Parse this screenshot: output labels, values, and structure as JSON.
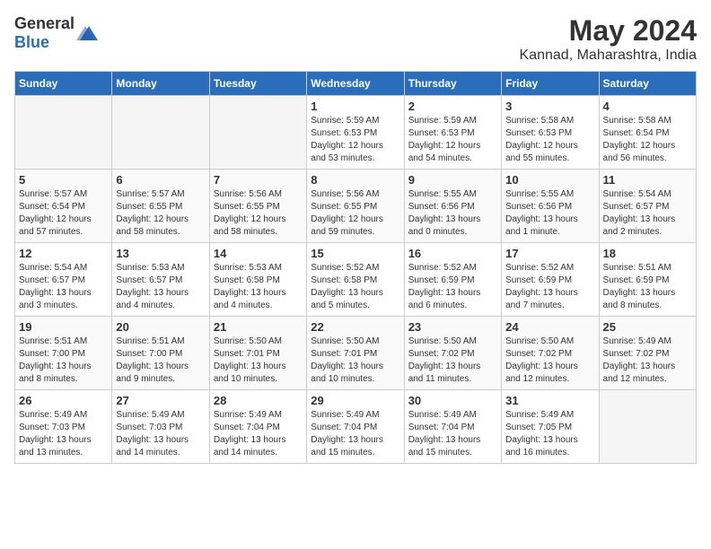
{
  "header": {
    "logo_general": "General",
    "logo_blue": "Blue",
    "month": "May 2024",
    "location": "Kannad, Maharashtra, India"
  },
  "weekdays": [
    "Sunday",
    "Monday",
    "Tuesday",
    "Wednesday",
    "Thursday",
    "Friday",
    "Saturday"
  ],
  "weeks": [
    [
      {
        "day": "",
        "info": ""
      },
      {
        "day": "",
        "info": ""
      },
      {
        "day": "",
        "info": ""
      },
      {
        "day": "1",
        "info": "Sunrise: 5:59 AM\nSunset: 6:53 PM\nDaylight: 12 hours\nand 53 minutes."
      },
      {
        "day": "2",
        "info": "Sunrise: 5:59 AM\nSunset: 6:53 PM\nDaylight: 12 hours\nand 54 minutes."
      },
      {
        "day": "3",
        "info": "Sunrise: 5:58 AM\nSunset: 6:53 PM\nDaylight: 12 hours\nand 55 minutes."
      },
      {
        "day": "4",
        "info": "Sunrise: 5:58 AM\nSunset: 6:54 PM\nDaylight: 12 hours\nand 56 minutes."
      }
    ],
    [
      {
        "day": "5",
        "info": "Sunrise: 5:57 AM\nSunset: 6:54 PM\nDaylight: 12 hours\nand 57 minutes."
      },
      {
        "day": "6",
        "info": "Sunrise: 5:57 AM\nSunset: 6:55 PM\nDaylight: 12 hours\nand 58 minutes."
      },
      {
        "day": "7",
        "info": "Sunrise: 5:56 AM\nSunset: 6:55 PM\nDaylight: 12 hours\nand 58 minutes."
      },
      {
        "day": "8",
        "info": "Sunrise: 5:56 AM\nSunset: 6:55 PM\nDaylight: 12 hours\nand 59 minutes."
      },
      {
        "day": "9",
        "info": "Sunrise: 5:55 AM\nSunset: 6:56 PM\nDaylight: 13 hours\nand 0 minutes."
      },
      {
        "day": "10",
        "info": "Sunrise: 5:55 AM\nSunset: 6:56 PM\nDaylight: 13 hours\nand 1 minute."
      },
      {
        "day": "11",
        "info": "Sunrise: 5:54 AM\nSunset: 6:57 PM\nDaylight: 13 hours\nand 2 minutes."
      }
    ],
    [
      {
        "day": "12",
        "info": "Sunrise: 5:54 AM\nSunset: 6:57 PM\nDaylight: 13 hours\nand 3 minutes."
      },
      {
        "day": "13",
        "info": "Sunrise: 5:53 AM\nSunset: 6:57 PM\nDaylight: 13 hours\nand 4 minutes."
      },
      {
        "day": "14",
        "info": "Sunrise: 5:53 AM\nSunset: 6:58 PM\nDaylight: 13 hours\nand 4 minutes."
      },
      {
        "day": "15",
        "info": "Sunrise: 5:52 AM\nSunset: 6:58 PM\nDaylight: 13 hours\nand 5 minutes."
      },
      {
        "day": "16",
        "info": "Sunrise: 5:52 AM\nSunset: 6:59 PM\nDaylight: 13 hours\nand 6 minutes."
      },
      {
        "day": "17",
        "info": "Sunrise: 5:52 AM\nSunset: 6:59 PM\nDaylight: 13 hours\nand 7 minutes."
      },
      {
        "day": "18",
        "info": "Sunrise: 5:51 AM\nSunset: 6:59 PM\nDaylight: 13 hours\nand 8 minutes."
      }
    ],
    [
      {
        "day": "19",
        "info": "Sunrise: 5:51 AM\nSunset: 7:00 PM\nDaylight: 13 hours\nand 8 minutes."
      },
      {
        "day": "20",
        "info": "Sunrise: 5:51 AM\nSunset: 7:00 PM\nDaylight: 13 hours\nand 9 minutes."
      },
      {
        "day": "21",
        "info": "Sunrise: 5:50 AM\nSunset: 7:01 PM\nDaylight: 13 hours\nand 10 minutes."
      },
      {
        "day": "22",
        "info": "Sunrise: 5:50 AM\nSunset: 7:01 PM\nDaylight: 13 hours\nand 10 minutes."
      },
      {
        "day": "23",
        "info": "Sunrise: 5:50 AM\nSunset: 7:02 PM\nDaylight: 13 hours\nand 11 minutes."
      },
      {
        "day": "24",
        "info": "Sunrise: 5:50 AM\nSunset: 7:02 PM\nDaylight: 13 hours\nand 12 minutes."
      },
      {
        "day": "25",
        "info": "Sunrise: 5:49 AM\nSunset: 7:02 PM\nDaylight: 13 hours\nand 12 minutes."
      }
    ],
    [
      {
        "day": "26",
        "info": "Sunrise: 5:49 AM\nSunset: 7:03 PM\nDaylight: 13 hours\nand 13 minutes."
      },
      {
        "day": "27",
        "info": "Sunrise: 5:49 AM\nSunset: 7:03 PM\nDaylight: 13 hours\nand 14 minutes."
      },
      {
        "day": "28",
        "info": "Sunrise: 5:49 AM\nSunset: 7:04 PM\nDaylight: 13 hours\nand 14 minutes."
      },
      {
        "day": "29",
        "info": "Sunrise: 5:49 AM\nSunset: 7:04 PM\nDaylight: 13 hours\nand 15 minutes."
      },
      {
        "day": "30",
        "info": "Sunrise: 5:49 AM\nSunset: 7:04 PM\nDaylight: 13 hours\nand 15 minutes."
      },
      {
        "day": "31",
        "info": "Sunrise: 5:49 AM\nSunset: 7:05 PM\nDaylight: 13 hours\nand 16 minutes."
      },
      {
        "day": "",
        "info": ""
      }
    ]
  ]
}
